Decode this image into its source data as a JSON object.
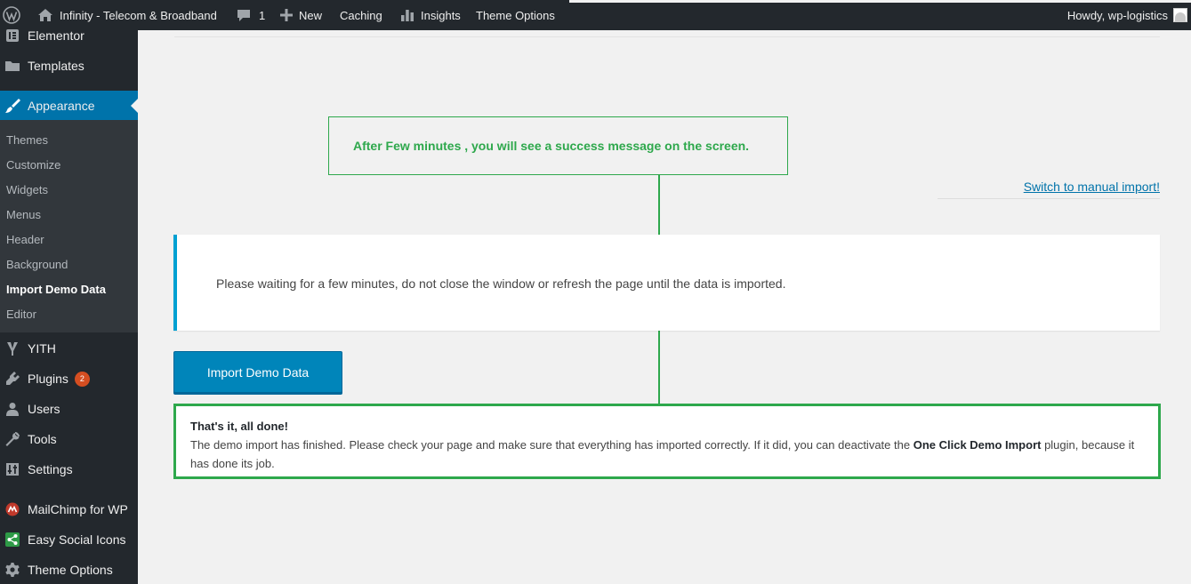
{
  "adminbar": {
    "site_name": "Infinity - Telecom & Broadband",
    "comments_count": "1",
    "new_label": "New",
    "caching_label": "Caching",
    "insights_label": "Insights",
    "theme_options_label": "Theme Options",
    "howdy_label": "Howdy, wp-logistics"
  },
  "sidebar": {
    "items": [
      {
        "label": "Elementor",
        "icon": "elementor-icon"
      },
      {
        "label": "Templates",
        "icon": "folder-icon"
      },
      {
        "label": "Appearance",
        "icon": "paintbrush-icon"
      },
      {
        "label": "YITH",
        "icon": "yith-icon"
      },
      {
        "label": "Plugins",
        "icon": "plugin-icon",
        "badge": "2"
      },
      {
        "label": "Users",
        "icon": "users-icon"
      },
      {
        "label": "Tools",
        "icon": "wrench-icon"
      },
      {
        "label": "Settings",
        "icon": "settings-icon"
      },
      {
        "label": "MailChimp for WP",
        "icon": "mailchimp-icon"
      },
      {
        "label": "Easy Social Icons",
        "icon": "share-icon"
      },
      {
        "label": "Theme Options",
        "icon": "gear-icon"
      }
    ],
    "submenu": [
      "Themes",
      "Customize",
      "Widgets",
      "Menus",
      "Header",
      "Background",
      "Import Demo Data",
      "Editor"
    ]
  },
  "main": {
    "callout": "After Few minutes , you will see a success message on the screen.",
    "switch_link": "Switch to manual import!",
    "notice": "Please waiting for a few minutes, do not close the window or refresh the page until the data is imported.",
    "import_button": "Import Demo Data",
    "done": {
      "title": "That's it, all done!",
      "text_before": "The demo import has finished. Please check your page and make sure that everything has imported correctly. If it did, you can deactivate the ",
      "plugin_name": "One Click Demo Import",
      "text_after": " plugin, because it has done its job."
    }
  },
  "colors": {
    "admin_dark": "#23282d",
    "submenu_bg": "#32373c",
    "accent": "#0073aa",
    "button": "#0085ba",
    "annotation_green": "#2ea84c",
    "notice_border": "#00a0d2",
    "badge": "#d54e21"
  }
}
